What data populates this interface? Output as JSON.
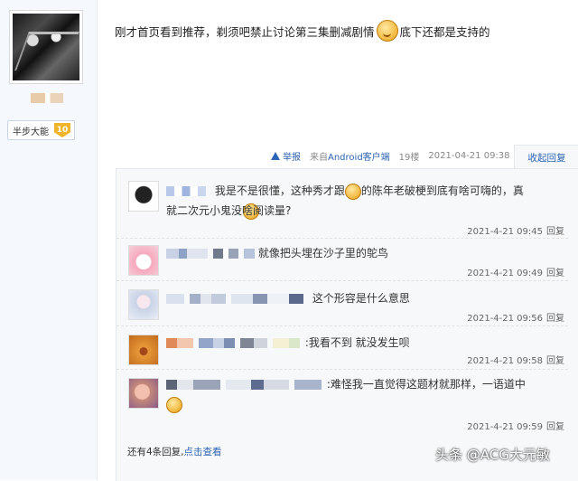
{
  "user": {
    "rank_label": "半步大能",
    "rank_level": "10"
  },
  "post": {
    "text_before": "刚才首页看到推荐，剃须吧禁止讨论第三集删减剧情",
    "text_after": "底下还都是支持的"
  },
  "meta": {
    "report": "举报",
    "client_prefix": "来自",
    "client_name": "Android客户端",
    "floor": "19楼",
    "timestamp": "2021-04-21 09:38",
    "collapse_label": "收起回复"
  },
  "replies": [
    {
      "text_line1": "我是不是很懂，这种秀才跟",
      "text_line1b": "的陈年老破梗到底有啥可嗨的，真",
      "text_line2": "就二次元小鬼没啥阅读量?",
      "time": "2021-4-21 09:45",
      "reply_label": "回复"
    },
    {
      "text_line1": "就像把头埋在沙子里的鸵鸟",
      "time": "2021-4-21 09:49",
      "reply_label": "回复"
    },
    {
      "text_line1": "这个形容是什么意思",
      "time": "2021-4-21 09:56",
      "reply_label": "回复"
    },
    {
      "text_line1": ":我看不到 就没发生呗",
      "time": "2021-4-21 09:58",
      "reply_label": "回复"
    },
    {
      "text_line1": ":难怪我一直觉得这题材就那样，一语道中",
      "time": "2021-4-21 09:59",
      "reply_label": "回复"
    }
  ],
  "footer": {
    "more_prefix": "还有4条回复,",
    "more_link": "点击查看"
  },
  "watermark": "头条 @ACG大元敏"
}
